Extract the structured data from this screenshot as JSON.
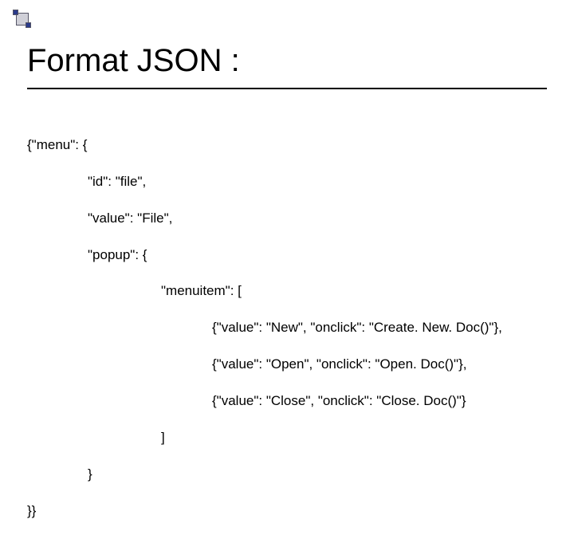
{
  "slide": {
    "title": "Format JSON :",
    "code": {
      "l0": "{\"menu\": {",
      "l1": "\"id\": \"file\",",
      "l2": "\"value\": \"File\",",
      "l3": "\"popup\": {",
      "l4": "\"menuitem\": [",
      "l5": "{\"value\": \"New\", \"onclick\": \"Create. New. Doc()\"},",
      "l6": "{\"value\": \"Open\", \"onclick\": \"Open. Doc()\"},",
      "l7": "{\"value\": \"Close\", \"onclick\": \"Close. Doc()\"}",
      "l8": "]",
      "l9": "}",
      "l10": "}}"
    }
  }
}
